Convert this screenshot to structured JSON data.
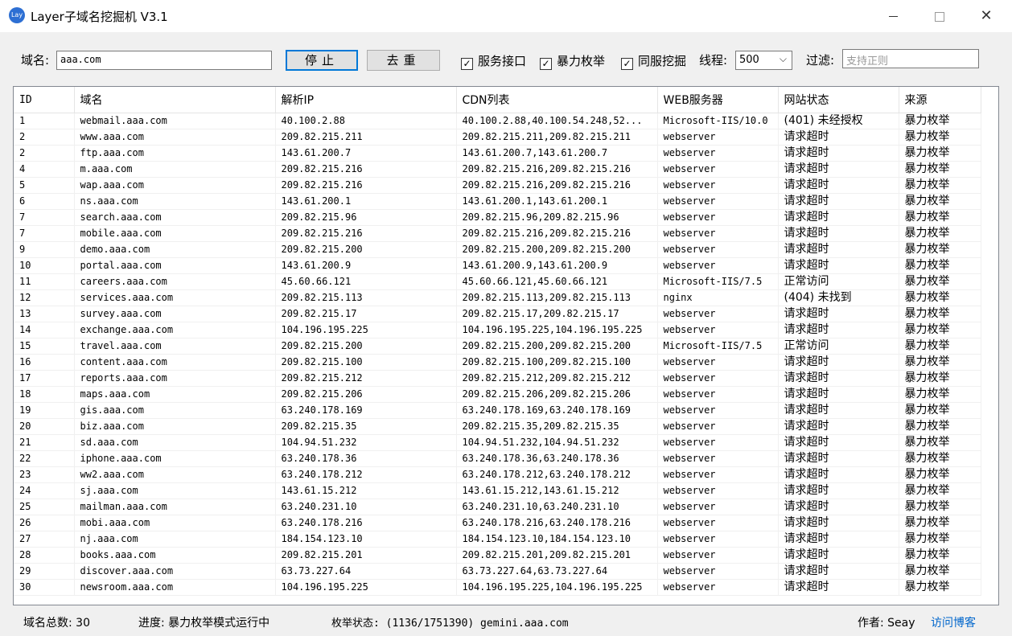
{
  "window": {
    "icon_text": "Lay",
    "title": "Layer子域名挖掘机 V3.1",
    "close_glyph": "✕"
  },
  "toolbar": {
    "domain_label": "域名:",
    "domain_value": "aaa.com",
    "stop_button": "停止",
    "dedupe_button": "去重",
    "chk_service": {
      "label": "服务接口",
      "checked": true
    },
    "chk_bruteforce": {
      "label": "暴力枚举",
      "checked": true
    },
    "chk_sameserver": {
      "label": "同服挖掘",
      "checked": true
    },
    "threads_label": "线程:",
    "threads_value": "500",
    "filter_label": "过滤:",
    "filter_placeholder": "支持正则"
  },
  "table": {
    "columns": [
      "ID",
      "域名",
      "解析IP",
      "CDN列表",
      "WEB服务器",
      "网站状态",
      "来源"
    ],
    "rows": [
      [
        "1",
        "webmail.aaa.com",
        "40.100.2.88",
        "40.100.2.88,40.100.54.248,52...",
        "Microsoft-IIS/10.0",
        "(401) 未经授权",
        "暴力枚举"
      ],
      [
        "2",
        "www.aaa.com",
        "209.82.215.211",
        "209.82.215.211,209.82.215.211",
        "webserver",
        "请求超时",
        "暴力枚举"
      ],
      [
        "2",
        "ftp.aaa.com",
        "143.61.200.7",
        "143.61.200.7,143.61.200.7",
        "webserver",
        "请求超时",
        "暴力枚举"
      ],
      [
        "4",
        "m.aaa.com",
        "209.82.215.216",
        "209.82.215.216,209.82.215.216",
        "webserver",
        "请求超时",
        "暴力枚举"
      ],
      [
        "5",
        "wap.aaa.com",
        "209.82.215.216",
        "209.82.215.216,209.82.215.216",
        "webserver",
        "请求超时",
        "暴力枚举"
      ],
      [
        "6",
        "ns.aaa.com",
        "143.61.200.1",
        "143.61.200.1,143.61.200.1",
        "webserver",
        "请求超时",
        "暴力枚举"
      ],
      [
        "7",
        "search.aaa.com",
        "209.82.215.96",
        "209.82.215.96,209.82.215.96",
        "webserver",
        "请求超时",
        "暴力枚举"
      ],
      [
        "7",
        "mobile.aaa.com",
        "209.82.215.216",
        "209.82.215.216,209.82.215.216",
        "webserver",
        "请求超时",
        "暴力枚举"
      ],
      [
        "9",
        "demo.aaa.com",
        "209.82.215.200",
        "209.82.215.200,209.82.215.200",
        "webserver",
        "请求超时",
        "暴力枚举"
      ],
      [
        "10",
        "portal.aaa.com",
        "143.61.200.9",
        "143.61.200.9,143.61.200.9",
        "webserver",
        "请求超时",
        "暴力枚举"
      ],
      [
        "11",
        "careers.aaa.com",
        "45.60.66.121",
        "45.60.66.121,45.60.66.121",
        "Microsoft-IIS/7.5",
        "正常访问",
        "暴力枚举"
      ],
      [
        "12",
        "services.aaa.com",
        "209.82.215.113",
        "209.82.215.113,209.82.215.113",
        "nginx",
        "(404) 未找到",
        "暴力枚举"
      ],
      [
        "13",
        "survey.aaa.com",
        "209.82.215.17",
        "209.82.215.17,209.82.215.17",
        "webserver",
        "请求超时",
        "暴力枚举"
      ],
      [
        "14",
        "exchange.aaa.com",
        "104.196.195.225",
        "104.196.195.225,104.196.195.225",
        "webserver",
        "请求超时",
        "暴力枚举"
      ],
      [
        "15",
        "travel.aaa.com",
        "209.82.215.200",
        "209.82.215.200,209.82.215.200",
        "Microsoft-IIS/7.5",
        "正常访问",
        "暴力枚举"
      ],
      [
        "16",
        "content.aaa.com",
        "209.82.215.100",
        "209.82.215.100,209.82.215.100",
        "webserver",
        "请求超时",
        "暴力枚举"
      ],
      [
        "17",
        "reports.aaa.com",
        "209.82.215.212",
        "209.82.215.212,209.82.215.212",
        "webserver",
        "请求超时",
        "暴力枚举"
      ],
      [
        "18",
        "maps.aaa.com",
        "209.82.215.206",
        "209.82.215.206,209.82.215.206",
        "webserver",
        "请求超时",
        "暴力枚举"
      ],
      [
        "19",
        "gis.aaa.com",
        "63.240.178.169",
        "63.240.178.169,63.240.178.169",
        "webserver",
        "请求超时",
        "暴力枚举"
      ],
      [
        "20",
        "biz.aaa.com",
        "209.82.215.35",
        "209.82.215.35,209.82.215.35",
        "webserver",
        "请求超时",
        "暴力枚举"
      ],
      [
        "21",
        "sd.aaa.com",
        "104.94.51.232",
        "104.94.51.232,104.94.51.232",
        "webserver",
        "请求超时",
        "暴力枚举"
      ],
      [
        "22",
        "iphone.aaa.com",
        "63.240.178.36",
        "63.240.178.36,63.240.178.36",
        "webserver",
        "请求超时",
        "暴力枚举"
      ],
      [
        "23",
        "ww2.aaa.com",
        "63.240.178.212",
        "63.240.178.212,63.240.178.212",
        "webserver",
        "请求超时",
        "暴力枚举"
      ],
      [
        "24",
        "sj.aaa.com",
        "143.61.15.212",
        "143.61.15.212,143.61.15.212",
        "webserver",
        "请求超时",
        "暴力枚举"
      ],
      [
        "25",
        "mailman.aaa.com",
        "63.240.231.10",
        "63.240.231.10,63.240.231.10",
        "webserver",
        "请求超时",
        "暴力枚举"
      ],
      [
        "26",
        "mobi.aaa.com",
        "63.240.178.216",
        "63.240.178.216,63.240.178.216",
        "webserver",
        "请求超时",
        "暴力枚举"
      ],
      [
        "27",
        "nj.aaa.com",
        "184.154.123.10",
        "184.154.123.10,184.154.123.10",
        "webserver",
        "请求超时",
        "暴力枚举"
      ],
      [
        "28",
        "books.aaa.com",
        "209.82.215.201",
        "209.82.215.201,209.82.215.201",
        "webserver",
        "请求超时",
        "暴力枚举"
      ],
      [
        "29",
        "discover.aaa.com",
        "63.73.227.64",
        "63.73.227.64,63.73.227.64",
        "webserver",
        "请求超时",
        "暴力枚举"
      ],
      [
        "30",
        "newsroom.aaa.com",
        "104.196.195.225",
        "104.196.195.225,104.196.195.225",
        "webserver",
        "请求超时",
        "暴力枚举"
      ]
    ]
  },
  "status": {
    "total": "域名总数: 30",
    "progress": "进度: 暴力枚举模式运行中",
    "enum_state": "枚举状态: (1136/1751390) gemini.aaa.com",
    "author": "作者: Seay",
    "blog_link": "访问博客"
  }
}
